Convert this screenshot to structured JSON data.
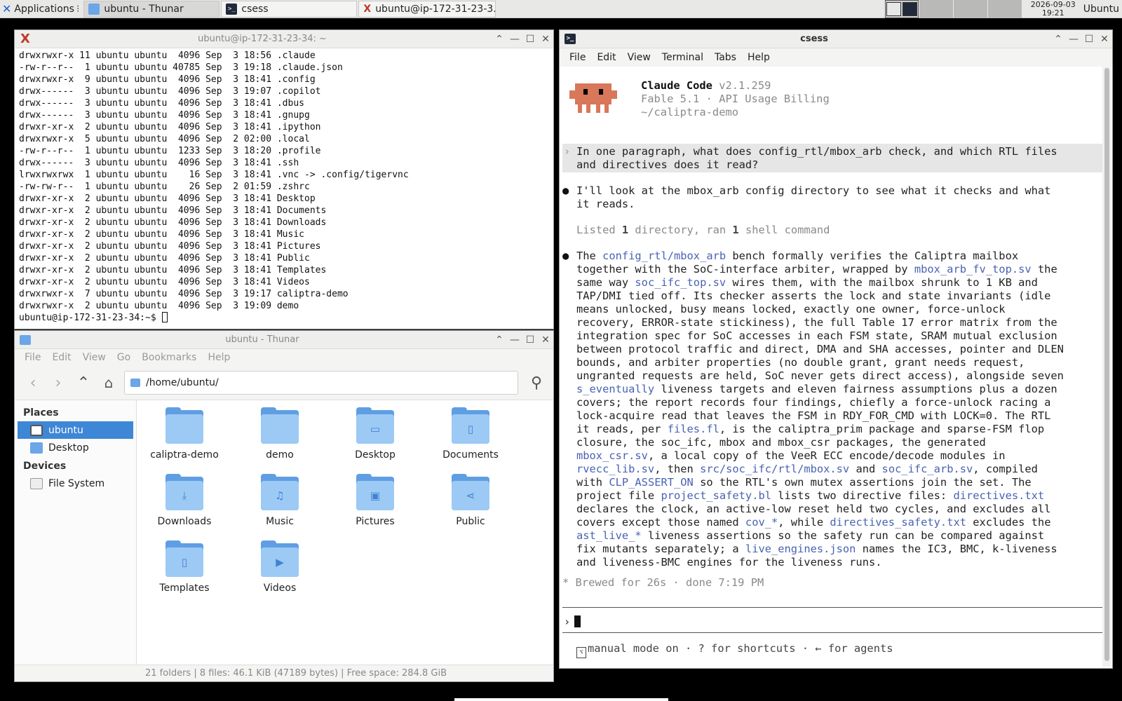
{
  "panel": {
    "applications_label": "Applications",
    "tasks": [
      {
        "label": "ubuntu - Thunar",
        "icon": "folder-icon"
      },
      {
        "label": "csess",
        "icon": "terminal-icon"
      },
      {
        "label": "ubuntu@ip-172-31-23-3...",
        "icon": "x-icon"
      }
    ],
    "clock_date": "2026-09-03",
    "clock_time": "19:21",
    "user": "Ubuntu"
  },
  "term1": {
    "title": "ubuntu@ip-172-31-23-34: ~",
    "lines": [
      "drwxrwxr-x 11 ubuntu ubuntu  4096 Sep  3 18:56 .claude",
      "-rw-r--r--  1 ubuntu ubuntu 40785 Sep  3 19:18 .claude.json",
      "drwxrwxr-x  9 ubuntu ubuntu  4096 Sep  3 18:41 .config",
      "drwx------  3 ubuntu ubuntu  4096 Sep  3 19:07 .copilot",
      "drwx------  3 ubuntu ubuntu  4096 Sep  3 18:41 .dbus",
      "drwx------  3 ubuntu ubuntu  4096 Sep  3 18:41 .gnupg",
      "drwxr-xr-x  2 ubuntu ubuntu  4096 Sep  3 18:41 .ipython",
      "drwxrwxr-x  5 ubuntu ubuntu  4096 Sep  2 02:00 .local",
      "-rw-r--r--  1 ubuntu ubuntu  1233 Sep  3 18:20 .profile",
      "drwx------  3 ubuntu ubuntu  4096 Sep  3 18:41 .ssh",
      "lrwxrwxrwx  1 ubuntu ubuntu    16 Sep  3 18:41 .vnc -> .config/tigervnc",
      "-rw-rw-r--  1 ubuntu ubuntu    26 Sep  2 01:59 .zshrc",
      "drwxr-xr-x  2 ubuntu ubuntu  4096 Sep  3 18:41 Desktop",
      "drwxr-xr-x  2 ubuntu ubuntu  4096 Sep  3 18:41 Documents",
      "drwxr-xr-x  2 ubuntu ubuntu  4096 Sep  3 18:41 Downloads",
      "drwxr-xr-x  2 ubuntu ubuntu  4096 Sep  3 18:41 Music",
      "drwxr-xr-x  2 ubuntu ubuntu  4096 Sep  3 18:41 Pictures",
      "drwxr-xr-x  2 ubuntu ubuntu  4096 Sep  3 18:41 Public",
      "drwxr-xr-x  2 ubuntu ubuntu  4096 Sep  3 18:41 Templates",
      "drwxr-xr-x  2 ubuntu ubuntu  4096 Sep  3 18:41 Videos",
      "drwxrwxr-x  7 ubuntu ubuntu  4096 Sep  3 19:17 caliptra-demo",
      "drwxrwxr-x  2 ubuntu ubuntu  4096 Sep  3 19:09 demo"
    ],
    "prompt": "ubuntu@ip-172-31-23-34:~$ "
  },
  "thunar": {
    "title": "ubuntu - Thunar",
    "menu": [
      "File",
      "Edit",
      "View",
      "Go",
      "Bookmarks",
      "Help"
    ],
    "location": "/home/ubuntu/",
    "places_heading": "Places",
    "places": [
      "ubuntu",
      "Desktop"
    ],
    "devices_heading": "Devices",
    "devices": [
      "File System"
    ],
    "items": [
      {
        "label": "caliptra-demo",
        "glyph": ""
      },
      {
        "label": "demo",
        "glyph": ""
      },
      {
        "label": "Desktop",
        "glyph": "▭"
      },
      {
        "label": "Documents",
        "glyph": "▯"
      },
      {
        "label": "Downloads",
        "glyph": "⤓"
      },
      {
        "label": "Music",
        "glyph": "♫"
      },
      {
        "label": "Pictures",
        "glyph": "▣"
      },
      {
        "label": "Public",
        "glyph": "⋖"
      },
      {
        "label": "Templates",
        "glyph": "▯"
      },
      {
        "label": "Videos",
        "glyph": "▶"
      }
    ],
    "status": "21 folders  |  8 files: 46.1 KiB (47189 bytes)  |  Free space: 284.8 GiB"
  },
  "term2": {
    "title": "csess",
    "menu": [
      "File",
      "Edit",
      "View",
      "Terminal",
      "Tabs",
      "Help"
    ],
    "app_name": "Claude Code",
    "version": "v2.1.259",
    "model_line": "Fable 5.1 · API Usage Billing",
    "cwd": "~/caliptra-demo",
    "user_prompt_1": "In one paragraph, what does config_rtl/mbox_arb check, and which RTL files",
    "user_prompt_2": "and directives does it read?",
    "msg1_1": "I'll look at the mbox_arb config directory to see what it checks and what",
    "msg1_2": "it reads.",
    "tool_a": "Listed ",
    "tool_n1": "1",
    "tool_b": " directory, ran ",
    "tool_n2": "1",
    "tool_c": " shell command",
    "answer": [
      [
        [
          "",
          "The "
        ],
        [
          "lnk",
          "config_rtl/mbox_arb"
        ],
        [
          "",
          " bench formally verifies the Caliptra mailbox"
        ]
      ],
      [
        [
          "",
          "together with the SoC-interface arbiter, wrapped by "
        ],
        [
          "lnk",
          "mbox_arb_fv_top.sv"
        ],
        [
          "",
          " the"
        ]
      ],
      [
        [
          "",
          "same way "
        ],
        [
          "lnk",
          "soc_ifc_top.sv"
        ],
        [
          "",
          " wires them, with the mailbox shrunk to 1 KB and"
        ]
      ],
      [
        [
          "",
          "TAP/DMI tied off. Its checker asserts the lock and state invariants (idle"
        ]
      ],
      [
        [
          "",
          "means unlocked, busy means locked, exactly one owner, force-unlock"
        ]
      ],
      [
        [
          "",
          "recovery, ERROR-state stickiness), the full Table 17 error matrix from the"
        ]
      ],
      [
        [
          "",
          "integration spec for SoC accesses in each FSM state, SRAM mutual exclusion"
        ]
      ],
      [
        [
          "",
          "between protocol traffic and direct, DMA and SHA accesses, pointer and DLEN"
        ]
      ],
      [
        [
          "",
          "bounds, and arbiter properties (no double grant, grant needs request,"
        ]
      ],
      [
        [
          "",
          "ungranted requests are held, SoC never gets direct access), alongside seven"
        ]
      ],
      [
        [
          "lnk",
          "s_eventually"
        ],
        [
          "",
          " liveness targets and eleven fairness assumptions plus a dozen"
        ]
      ],
      [
        [
          "",
          "covers; the report records four findings, chiefly a force-unlock racing a"
        ]
      ],
      [
        [
          "",
          "lock-acquire read that leaves the FSM in RDY_FOR_CMD with LOCK=0. The RTL"
        ]
      ],
      [
        [
          "",
          "it reads, per "
        ],
        [
          "lnk",
          "files.fl"
        ],
        [
          "",
          ", is the caliptra_prim package and sparse-FSM flop"
        ]
      ],
      [
        [
          "",
          "closure, the soc_ifc, mbox and mbox_csr packages, the generated"
        ]
      ],
      [
        [
          "lnk",
          "mbox_csr.sv"
        ],
        [
          "",
          ", a local copy of the VeeR ECC encode/decode modules in"
        ]
      ],
      [
        [
          "lnk",
          "rvecc_lib.sv"
        ],
        [
          "",
          ", then "
        ],
        [
          "lnk",
          "src/soc_ifc/rtl/mbox.sv"
        ],
        [
          "",
          " and "
        ],
        [
          "lnk",
          "soc_ifc_arb.sv"
        ],
        [
          "",
          ", compiled"
        ]
      ],
      [
        [
          "",
          "with "
        ],
        [
          "lnk",
          "CLP_ASSERT_ON"
        ],
        [
          "",
          " so the RTL's own mutex assertions join the set. The"
        ]
      ],
      [
        [
          "",
          "project file "
        ],
        [
          "lnk",
          "project_safety.bl"
        ],
        [
          "",
          " lists two directive files: "
        ],
        [
          "lnk",
          "directives.txt"
        ]
      ],
      [
        [
          "",
          "declares the clock, an active-low reset held two cycles, and excludes all"
        ]
      ],
      [
        [
          "",
          "covers except those named "
        ],
        [
          "lnk",
          "cov_*"
        ],
        [
          "",
          ", while "
        ],
        [
          "lnk",
          "directives_safety.txt"
        ],
        [
          "",
          " excludes the"
        ]
      ],
      [
        [
          "lnk",
          "ast_live_*"
        ],
        [
          "",
          " liveness assertions so the safety run can be compared against"
        ]
      ],
      [
        [
          "",
          "fix mutants separately; a "
        ],
        [
          "lnk",
          "live_engines.json"
        ],
        [
          "",
          " names the IC3, BMC, k-liveness"
        ]
      ],
      [
        [
          "",
          "and liveness-BMC engines for the liveness runs."
        ]
      ]
    ],
    "brewed": "* Brewed for 26s · done 7:19 PM",
    "footer": "manual mode on · ? for shortcuts · ← for agents"
  },
  "colors": {
    "link": "#4a62b3",
    "mascot": "#d9775b",
    "selection": "#3d87d6",
    "folder": "#9ccaf5"
  }
}
